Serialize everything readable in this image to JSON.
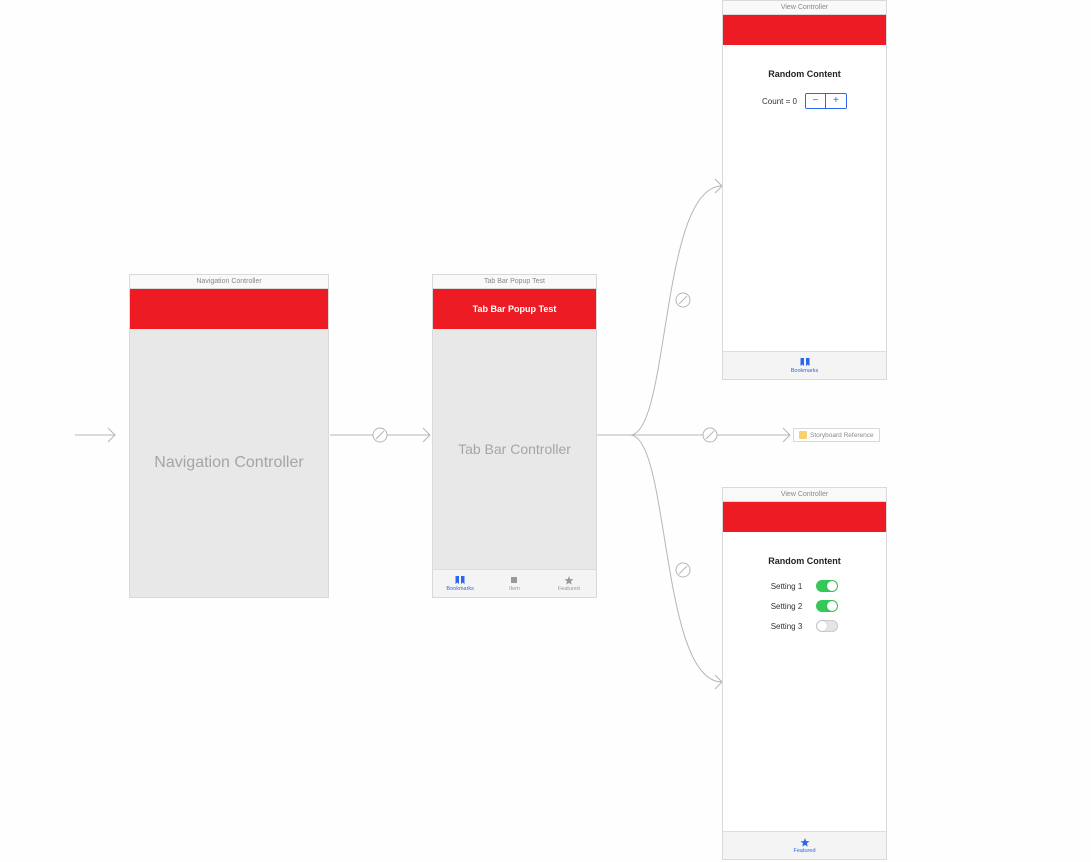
{
  "scenes": {
    "nav": {
      "title": "Navigation Controller",
      "body_label": "Navigation Controller"
    },
    "tabbar": {
      "title": "Tab Bar Popup Test",
      "nav_title": "Tab Bar Popup Test",
      "body_label": "Tab Bar Controller",
      "tabs": [
        {
          "label": "Bookmarks",
          "active": true
        },
        {
          "label": "Item",
          "active": false
        },
        {
          "label": "Featured",
          "active": false
        }
      ]
    },
    "vc1": {
      "title": "View Controller",
      "heading": "Random Content",
      "count_label": "Count = 0",
      "stepper_minus": "−",
      "stepper_plus": "+",
      "tab_label": "Bookmarks"
    },
    "storyboard_ref": {
      "label": "Storyboard Reference"
    },
    "vc2": {
      "title": "View Controller",
      "heading": "Random Content",
      "settings": [
        {
          "label": "Setting 1",
          "on": true
        },
        {
          "label": "Setting 2",
          "on": true
        },
        {
          "label": "Setting 3",
          "on": false
        }
      ],
      "tab_label": "Featured"
    }
  }
}
